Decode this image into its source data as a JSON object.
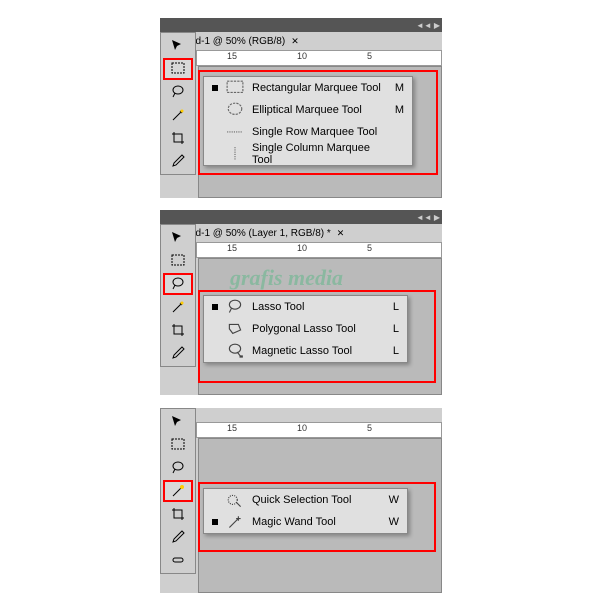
{
  "panel1": {
    "tab": "ed-1 @ 50% (RGB/8)",
    "ruler": [
      "15",
      "10",
      "5"
    ],
    "flyout": [
      {
        "current": true,
        "label": "Rectangular Marquee Tool",
        "key": "M",
        "icon": "rect-marquee"
      },
      {
        "current": false,
        "label": "Elliptical Marquee Tool",
        "key": "M",
        "icon": "ellipse-marquee"
      },
      {
        "current": false,
        "label": "Single Row Marquee Tool",
        "key": "",
        "icon": "row-marquee"
      },
      {
        "current": false,
        "label": "Single Column Marquee Tool",
        "key": "",
        "icon": "col-marquee"
      }
    ]
  },
  "panel2": {
    "tab": "ed-1 @ 50% (Layer 1, RGB/8) *",
    "ruler": [
      "15",
      "10",
      "5"
    ],
    "watermark": "grafis media",
    "flyout": [
      {
        "current": true,
        "label": "Lasso Tool",
        "key": "L",
        "icon": "lasso"
      },
      {
        "current": false,
        "label": "Polygonal Lasso Tool",
        "key": "L",
        "icon": "poly-lasso"
      },
      {
        "current": false,
        "label": "Magnetic Lasso Tool",
        "key": "L",
        "icon": "mag-lasso"
      }
    ]
  },
  "panel3": {
    "ruler": [
      "15",
      "10",
      "5"
    ],
    "flyout": [
      {
        "current": false,
        "label": "Quick Selection Tool",
        "key": "W",
        "icon": "quick-sel"
      },
      {
        "current": true,
        "label": "Magic Wand Tool",
        "key": "W",
        "icon": "wand"
      }
    ]
  }
}
